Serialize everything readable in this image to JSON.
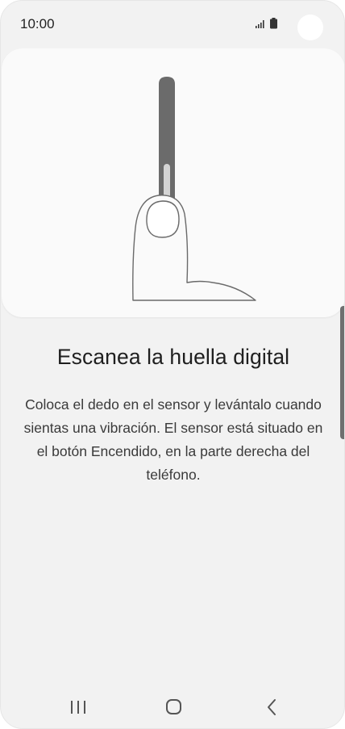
{
  "status_bar": {
    "time": "10:00",
    "signal_icon": "signal-bars-icon",
    "battery_icon": "battery-icon"
  },
  "illustration": {
    "icon": "finger-on-side-sensor-illustration"
  },
  "content": {
    "title": "Escanea la huella digital",
    "description": "Coloca el dedo en el sensor y levántalo cuando sientas una vibración. El sensor está situado en el botón Encendido, en la parte derecha del teléfono."
  },
  "nav_bar": {
    "recents_icon": "recents-icon",
    "home_icon": "home-icon",
    "back_icon": "back-icon"
  },
  "colors": {
    "background": "#f2f2f2",
    "card": "#fafafa",
    "text_primary": "#1f1f1f",
    "text_secondary": "#3a3a3a"
  }
}
